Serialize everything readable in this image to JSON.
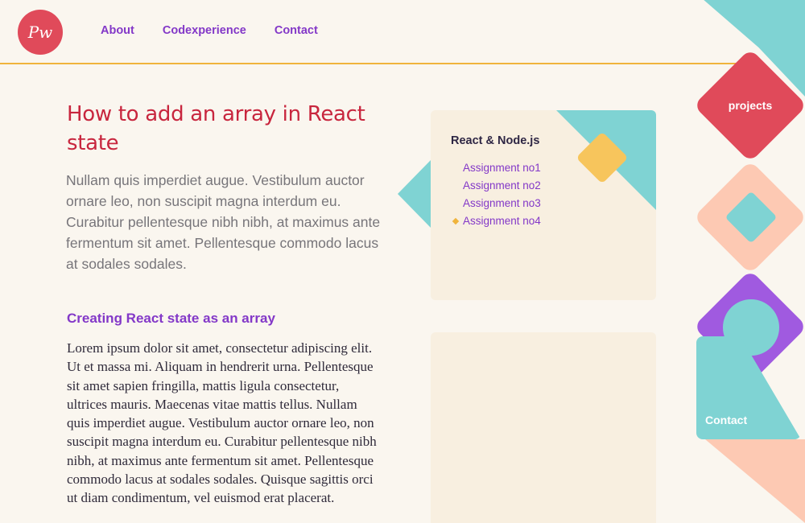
{
  "header": {
    "logo_text": "Pw",
    "nav": [
      "About",
      "Codexperience",
      "Contact"
    ]
  },
  "article": {
    "title": "How to add an array in React state",
    "lead": "Nullam quis imperdiet augue. Vestibulum auctor ornare leo, non suscipit magna interdum eu. Curabitur pellentesque nibh nibh, at maximus ante fermentum sit amet. Pellentesque commodo lacus at sodales sodales.",
    "subheading": "Creating React state as an array",
    "body": "Lorem ipsum dolor sit amet, consectetur adipiscing elit. Ut et massa mi. Aliquam in hendrerit urna. Pellentesque sit amet sapien fringilla, mattis ligula consectetur, ultrices mauris. Maecenas vitae mattis tellus. Nullam quis imperdiet augue. Vestibulum auctor ornare leo, non suscipit magna interdum eu. Curabitur pellentesque nibh nibh, at maximus ante fermentum sit amet. Pellentesque commodo lacus at sodales sodales. Quisque sagittis orci ut diam condimentum, vel euismod erat placerat."
  },
  "sidebar_card": {
    "title": "React & Node.js",
    "assignments": [
      "Assignment no1",
      "Assignment no2",
      "Assignment no3",
      "Assignment no4"
    ],
    "active_index": 3
  },
  "deco": {
    "projects_label": "projects",
    "contact_label": "Contact"
  },
  "colors": {
    "background": "#faf6ef",
    "accent_red": "#c8263e",
    "accent_purple": "#8338c8",
    "teal": "#7fd3d3",
    "yellow": "#f7c55c",
    "peach": "#fdc9b3",
    "rule": "#f0b43c"
  }
}
